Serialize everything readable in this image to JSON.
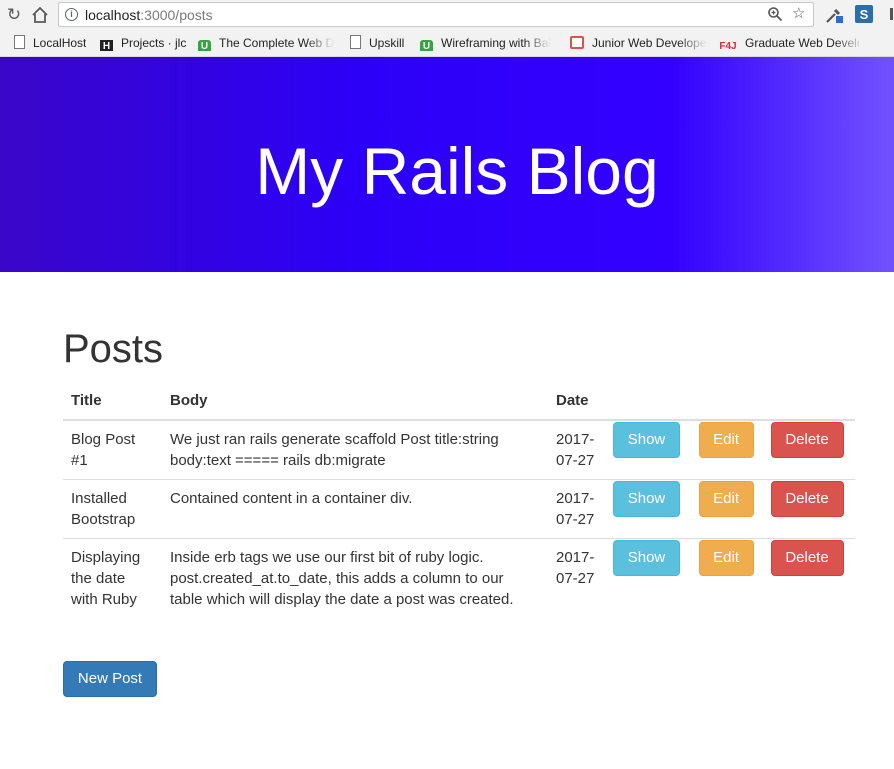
{
  "browser": {
    "url_host": "localhost",
    "url_path": ":3000/posts",
    "bookmarks": [
      {
        "label": "LocalHost",
        "icon": "page-icon"
      },
      {
        "label": "Projects · jlc",
        "icon": "h-icon"
      },
      {
        "label": "The Complete Web D",
        "icon": "u-icon"
      },
      {
        "label": "Upskill",
        "icon": "page-icon"
      },
      {
        "label": "Wireframing with Bal",
        "icon": "u-icon"
      },
      {
        "label": "Junior Web Develope",
        "icon": "bag-icon"
      },
      {
        "label": "Graduate Web Develo",
        "icon": "f4j-icon"
      }
    ]
  },
  "hero": {
    "title": "My Rails Blog",
    "gradient": [
      "#3a06c8",
      "#2c00f7",
      "#3300ff",
      "#7252ff"
    ]
  },
  "page": {
    "heading": "Posts",
    "columns": [
      "Title",
      "Body",
      "Date"
    ],
    "buttons": {
      "show": "Show",
      "edit": "Edit",
      "delete": "Delete"
    },
    "new_post": "New Post"
  },
  "posts": [
    {
      "title": "Blog Post #1",
      "body": "We just ran rails generate scaffold Post title:string body:text ===== rails db:migrate",
      "date": "2017-07-27"
    },
    {
      "title": "Installed Bootstrap",
      "body": "Contained content in a container div.",
      "date": "2017-07-27"
    },
    {
      "title": "Displaying the date with Ruby",
      "body": "Inside erb tags we use our first bit of ruby logic. post.created_at.to_date, this adds a column to our table which will display the date a post was created.",
      "date": "2017-07-27"
    }
  ],
  "colors": {
    "show": "#5bc0de",
    "edit": "#f0ad4e",
    "delete": "#d9534f",
    "primary": "#337ab7"
  }
}
